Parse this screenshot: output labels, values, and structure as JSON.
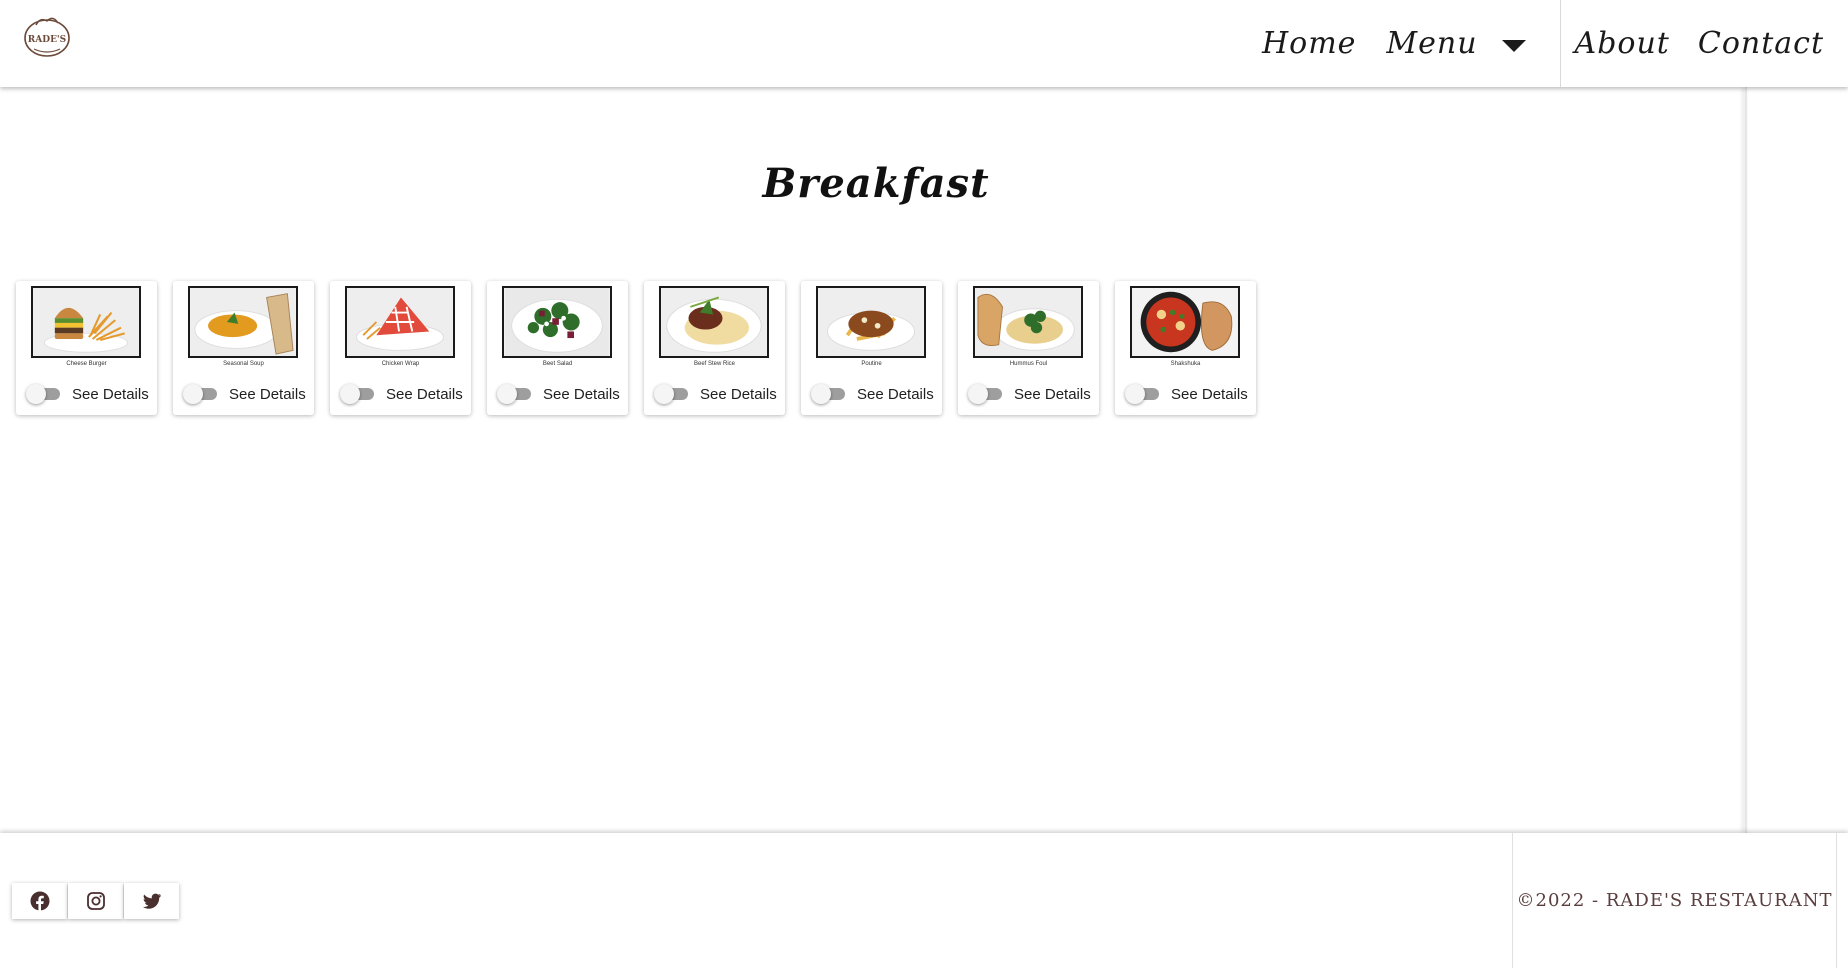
{
  "header": {
    "logo_text": "RADE'S",
    "nav": {
      "home": "Home",
      "menu": "Menu",
      "about": "About",
      "contact": "Contact"
    }
  },
  "main": {
    "title": "Breakfast",
    "cards": [
      {
        "name": "Cheese Burger",
        "toggle_label": "See Details",
        "checked": false,
        "icon": "burger-image"
      },
      {
        "name": "Seasonal Soup",
        "toggle_label": "See Details",
        "checked": false,
        "icon": "soup-image"
      },
      {
        "name": "Chicken Wrap",
        "toggle_label": "See Details",
        "checked": false,
        "icon": "wrap-image"
      },
      {
        "name": "Beet Salad",
        "toggle_label": "See Details",
        "checked": false,
        "icon": "salad-image"
      },
      {
        "name": "Beef Stew Rice",
        "toggle_label": "See Details",
        "checked": false,
        "icon": "stew-image"
      },
      {
        "name": "Poutine",
        "toggle_label": "See Details",
        "checked": false,
        "icon": "poutine-image"
      },
      {
        "name": "Hummus Foul",
        "toggle_label": "See Details",
        "checked": false,
        "icon": "hummus-image"
      },
      {
        "name": "Shakshuka",
        "toggle_label": "See Details",
        "checked": false,
        "icon": "shakshuka-image"
      }
    ]
  },
  "footer": {
    "social": [
      {
        "name": "facebook",
        "icon": "facebook-icon"
      },
      {
        "name": "instagram",
        "icon": "instagram-icon"
      },
      {
        "name": "twitter",
        "icon": "twitter-icon"
      }
    ],
    "copyright": "©2022 - RADE'S RESTAURANT"
  },
  "colors": {
    "brand_brown": "#5a3e3e",
    "toggle_track": "#9e9e9e",
    "text_dark": "#1a1a1a"
  }
}
